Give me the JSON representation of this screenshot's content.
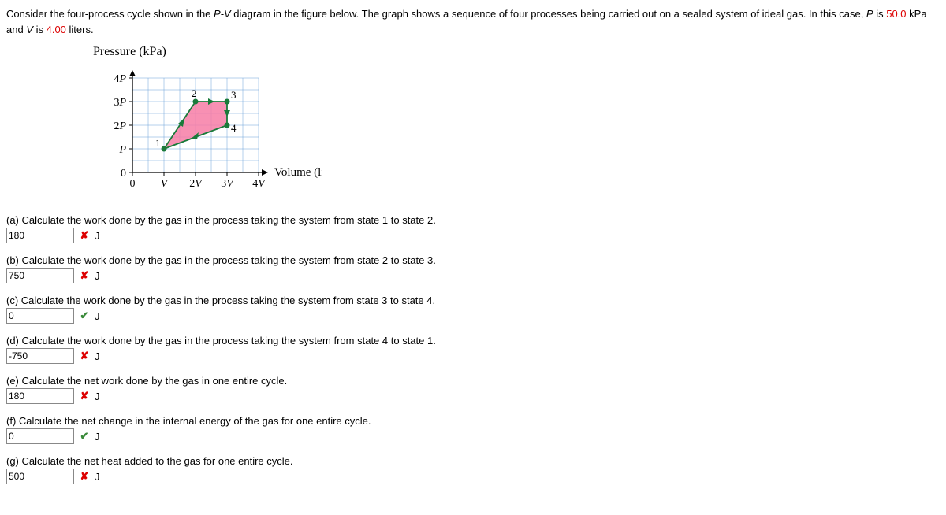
{
  "problem": {
    "prefix": "Consider the four-process cycle shown in the ",
    "pv": "P-V",
    "mid": " diagram in the figure below. The graph shows a sequence of four processes being carried out on a sealed system of ideal gas. In this case, ",
    "P": "P",
    "is": " is ",
    "Pval": "50.0",
    "Punit": " kPa and ",
    "V": "V",
    "Vval": "4.00",
    "Vunit": " liters."
  },
  "diagram": {
    "title": "Pressure (kPa)",
    "xlabel": "Volume (liters)",
    "ylabels": [
      "0",
      "P",
      "2P",
      "3P",
      "4P"
    ],
    "xlabels": [
      "0",
      "V",
      "2V",
      "3V",
      "4V"
    ],
    "points": {
      "1": "1",
      "2": "2",
      "3": "3",
      "4": "4"
    }
  },
  "chart_data": {
    "type": "line",
    "title": "Pressure (kPa)",
    "xlabel": "Volume (liters)",
    "ylabel": "Pressure (kPa)",
    "x_ticks": [
      "0",
      "V",
      "2V",
      "3V",
      "4V"
    ],
    "y_ticks": [
      "0",
      "P",
      "2P",
      "3P",
      "4P"
    ],
    "xlim": [
      0,
      4
    ],
    "ylim": [
      0,
      4
    ],
    "P": 50.0,
    "V": 4.0,
    "states": [
      {
        "label": "1",
        "x_in_V": 1,
        "y_in_P": 1
      },
      {
        "label": "2",
        "x_in_V": 2,
        "y_in_P": 3
      },
      {
        "label": "3",
        "x_in_V": 3,
        "y_in_P": 3
      },
      {
        "label": "4",
        "x_in_V": 3,
        "y_in_P": 2
      }
    ],
    "cycle_order": [
      "1",
      "2",
      "3",
      "4",
      "1"
    ],
    "shaded_region": true
  },
  "questions": {
    "a": {
      "text": "(a) Calculate the work done by the gas in the process taking the system from state 1 to state 2.",
      "value": "180",
      "unit": "J",
      "status": "wrong"
    },
    "b": {
      "text": "(b) Calculate the work done by the gas in the process taking the system from state 2 to state 3.",
      "value": "750",
      "unit": "J",
      "status": "wrong"
    },
    "c": {
      "text": "(c) Calculate the work done by the gas in the process taking the system from state 3 to state 4.",
      "value": "0",
      "unit": "J",
      "status": "correct"
    },
    "d": {
      "text": "(d) Calculate the work done by the gas in the process taking the system from state 4 to state 1.",
      "value": "-750",
      "unit": "J",
      "status": "wrong"
    },
    "e": {
      "text": "(e) Calculate the net work done by the gas in one entire cycle.",
      "value": "180",
      "unit": "J",
      "status": "wrong"
    },
    "f": {
      "text": "(f) Calculate the net change in the internal energy of the gas for one entire cycle.",
      "value": "0",
      "unit": "J",
      "status": "correct"
    },
    "g": {
      "text": "(g) Calculate the net heat added to the gas for one entire cycle.",
      "value": "500",
      "unit": "J",
      "status": "wrong"
    }
  },
  "glyphs": {
    "wrong": "✘",
    "correct": "✔"
  }
}
